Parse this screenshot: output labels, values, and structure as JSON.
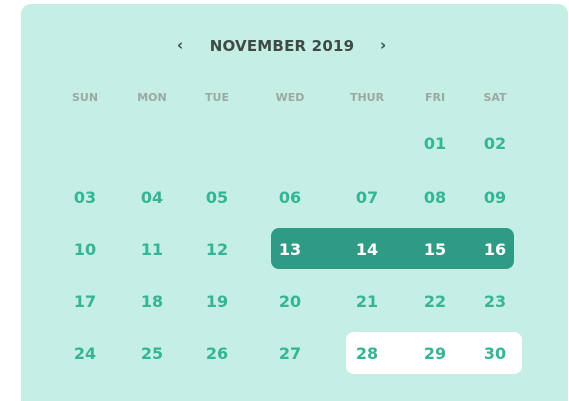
{
  "header": {
    "prev_icon": "‹",
    "next_icon": "›",
    "month_label": "NOVEMBER 2019"
  },
  "weekdays": [
    "SUN",
    "MON",
    "TUE",
    "WED",
    "THUR",
    "FRI",
    "SAT"
  ],
  "weeks": [
    [
      "",
      "",
      "",
      "",
      "",
      "01",
      "02"
    ],
    [
      "03",
      "04",
      "05",
      "06",
      "07",
      "08",
      "09"
    ],
    [
      "10",
      "11",
      "12",
      "13",
      "14",
      "15",
      "16"
    ],
    [
      "17",
      "18",
      "19",
      "20",
      "21",
      "22",
      "23"
    ],
    [
      "24",
      "25",
      "26",
      "27",
      "28",
      "29",
      "30"
    ]
  ],
  "selected_range": [
    "13",
    "14",
    "15",
    "16"
  ],
  "highlighted_days": [
    "28",
    "29",
    "30"
  ],
  "colors": {
    "background": "#c5efe4",
    "day_text": "#35b595",
    "selected_bg": "#2f9b84",
    "selected_text": "#ffffff",
    "highlight_bg": "#ffffff",
    "weekday_text": "#9ba8a4",
    "title_text": "#3d4a47"
  }
}
